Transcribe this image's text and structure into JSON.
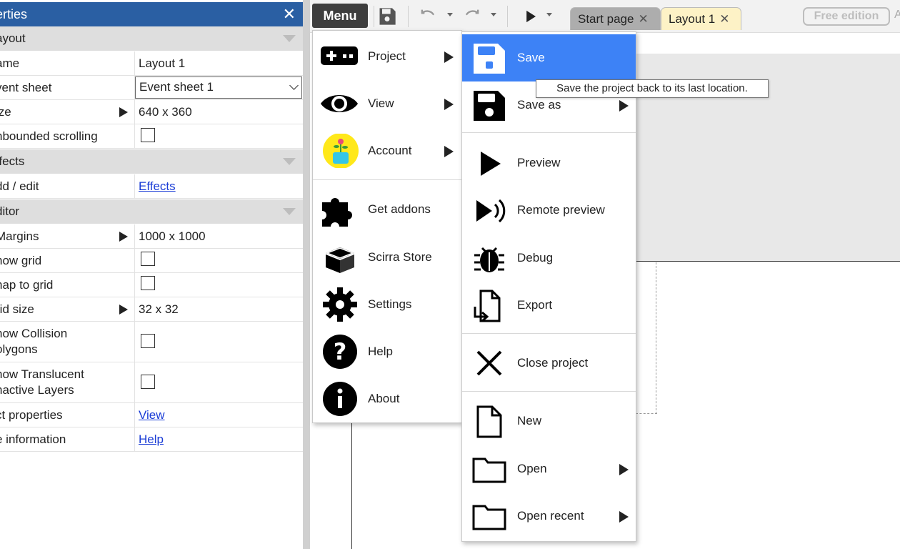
{
  "properties_panel": {
    "title": "erties",
    "close_glyph": "✕",
    "rows": [
      {
        "type": "section",
        "label": "ayout"
      },
      {
        "type": "text",
        "label": "ame",
        "value": "Layout 1"
      },
      {
        "type": "select",
        "label": "vent sheet",
        "value": "Event sheet 1"
      },
      {
        "type": "expand",
        "label": "ize",
        "value": "640 x 360"
      },
      {
        "type": "check",
        "label": "nbounded scrolling",
        "checked": false
      },
      {
        "type": "section",
        "label": "ffects"
      },
      {
        "type": "link",
        "label": "dd / edit",
        "value": "Effects"
      },
      {
        "type": "section",
        "label": "ditor"
      },
      {
        "type": "expand",
        "label": "Margins",
        "value": "1000 x 1000"
      },
      {
        "type": "check",
        "label": "how grid",
        "checked": false
      },
      {
        "type": "check",
        "label": "nap to grid",
        "checked": false
      },
      {
        "type": "expand",
        "label": "rid size",
        "value": "32 x 32"
      },
      {
        "type": "check",
        "label": "how Collision\nolygons",
        "checked": false
      },
      {
        "type": "check",
        "label": "how Translucent\nnactive Layers",
        "checked": false
      },
      {
        "type": "link",
        "label": "ct properties",
        "value": "View"
      },
      {
        "type": "link",
        "label": "e information",
        "value": "Help"
      }
    ]
  },
  "toolbar": {
    "menu_label": "Menu",
    "tabs": [
      {
        "label": "Start page",
        "close": "✕",
        "active": false
      },
      {
        "label": "Layout 1",
        "close": "✕",
        "active": true
      }
    ],
    "badge": "Free edition",
    "trailing": "A"
  },
  "main_menu": {
    "items": [
      {
        "label": "Project",
        "icon": "gamepad-icon",
        "submenu": true
      },
      {
        "label": "View",
        "icon": "eye-icon",
        "submenu": true
      },
      {
        "label": "Account",
        "icon": "avatar-icon",
        "submenu": true
      },
      {
        "label": "Get addons",
        "icon": "puzzle-icon",
        "submenu": false
      },
      {
        "label": "Scirra Store",
        "icon": "box-icon",
        "submenu": false
      },
      {
        "label": "Settings",
        "icon": "gear-icon",
        "submenu": false
      },
      {
        "label": "Help",
        "icon": "question-icon",
        "submenu": false
      },
      {
        "label": "About",
        "icon": "info-icon",
        "submenu": false
      }
    ]
  },
  "project_menu": {
    "items": [
      {
        "label": "Save",
        "icon": "save-icon",
        "submenu": false,
        "highlighted": true
      },
      {
        "label": "Save as",
        "icon": "save-as-icon",
        "submenu": true
      },
      {
        "label": "Preview",
        "icon": "play-icon",
        "submenu": false
      },
      {
        "label": "Remote preview",
        "icon": "remote-preview-icon",
        "submenu": false
      },
      {
        "label": "Debug",
        "icon": "bug-icon",
        "submenu": false
      },
      {
        "label": "Export",
        "icon": "export-icon",
        "submenu": false
      },
      {
        "label": "Close project",
        "icon": "close-icon",
        "submenu": false
      },
      {
        "label": "New",
        "icon": "new-file-icon",
        "submenu": false
      },
      {
        "label": "Open",
        "icon": "folder-icon",
        "submenu": true
      },
      {
        "label": "Open recent",
        "icon": "folder-recent-icon",
        "submenu": true
      }
    ]
  },
  "tooltip": {
    "text": "Save the project back to its last location."
  },
  "colors": {
    "highlight": "#3d82f6",
    "titlebar": "#2a5fa3",
    "active_tab": "#fdf2c6",
    "link": "#1a3cd6"
  }
}
